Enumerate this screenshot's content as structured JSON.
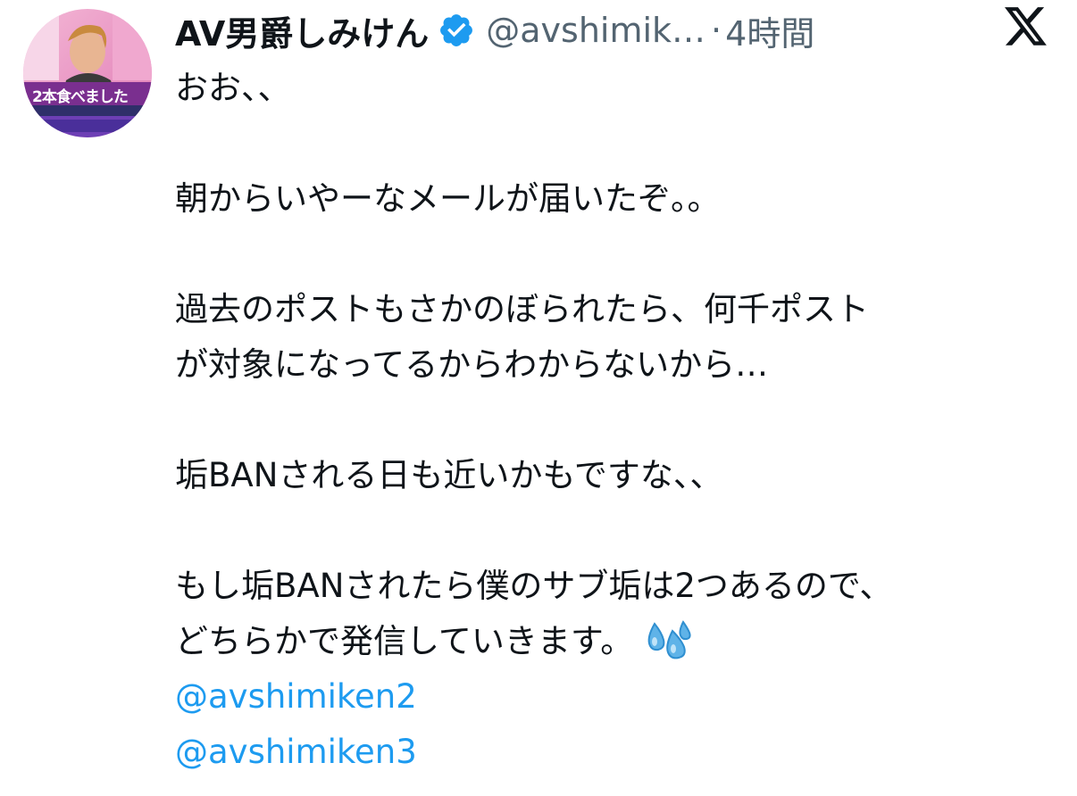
{
  "tweet": {
    "author": {
      "display_name": "AV男爵しみけん",
      "handle": "@avshimik…",
      "verified": true,
      "avatar_icon": "profile-photo",
      "avatar_caption": "2本食べました"
    },
    "separator": "·",
    "time": "4時間",
    "brand_icon": "x-logo-icon",
    "lines": [
      "おお、、",
      "",
      "朝からいやーなメールが届いたぞ。。",
      "",
      "過去のポストもさかのぼられたら、何千ポスト",
      "が対象になってるからわからないから…",
      "",
      "垢BANされる日も近いかもですな、、",
      "",
      "もし垢BANされたら僕のサブ垢は2つあるので、",
      "どちらかで発信していきます。"
    ],
    "emoji_icon": "sweat-droplets-icon",
    "mentions": [
      "@avshimiken2",
      "@avshimiken3"
    ],
    "colors": {
      "text": "#0f1419",
      "secondary": "#536471",
      "link": "#1d9bf0",
      "verified_badge": "#1d9bf0"
    }
  }
}
